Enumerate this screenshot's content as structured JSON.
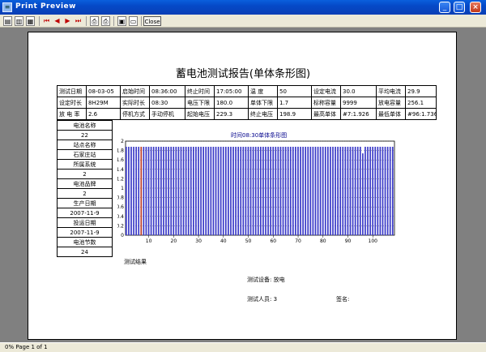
{
  "window": {
    "title": "Print Preview",
    "icon": "preview-icon"
  },
  "toolbar": {
    "icons": [
      "single-page-icon",
      "two-page-icon",
      "multi-page-icon",
      "first-page-icon",
      "prev-page-icon",
      "next-page-icon",
      "last-page-icon",
      "print-icon",
      "printer-setup-icon",
      "save-icon",
      "open-icon"
    ],
    "close_label": "Close"
  },
  "status": {
    "text": "0% Page 1 of 1"
  },
  "report": {
    "title": "蓄电池测试报告(单体条形图)",
    "info_rows": [
      [
        "测试日期",
        "08-03-05",
        "启始时间",
        "08:36:00",
        "终止时间",
        "17:05:00",
        "温    度",
        "50",
        "设定电流",
        "30.0",
        "平均电流",
        "29.9"
      ],
      [
        "设定时长",
        "8H29M",
        "实际时长",
        "08:30",
        "电压下限",
        "180.0",
        "单体下限",
        "1.7",
        "标称容量",
        "9999",
        "放电容量",
        "256.1"
      ],
      [
        "放 电 率",
        "2.6",
        "停机方式",
        "手动停机",
        "起始电压",
        "229.3",
        "终止电压",
        "198.9",
        "最高单体",
        "#7:1.926",
        "最低单体",
        "#96:1.736"
      ]
    ],
    "side_rows": [
      "电池名称",
      "22",
      "站点名称",
      "石家庄站",
      "所属系统",
      "2",
      "电池品牌",
      "2",
      "生产日期",
      "2007-11-9",
      "投运日期",
      "2007-11-9",
      "电池节数",
      "24"
    ],
    "test_result_label": "测试结果",
    "test_device": "测试设备: 放电",
    "tester": "测试人员: 3",
    "signature": "签名:"
  },
  "chart_data": {
    "type": "bar",
    "title": "时间08:30单体条形图",
    "x_ticks": [
      10,
      20,
      30,
      40,
      50,
      60,
      70,
      80,
      90,
      100
    ],
    "y_ticks": [
      0,
      0.2,
      0.4,
      0.6,
      0.8,
      1.0,
      1.2,
      1.4,
      1.6,
      1.8,
      2
    ],
    "ylim": [
      0,
      2
    ],
    "xlim": [
      1,
      108
    ],
    "bar_count": 108,
    "typical_value": 1.88,
    "highlight_indices": [
      7
    ],
    "low_indices": [
      96
    ],
    "colors": {
      "bar": "#3a3ac8",
      "highlight": "#b83a2a",
      "grid": "#000000",
      "title": "#00008b"
    }
  }
}
